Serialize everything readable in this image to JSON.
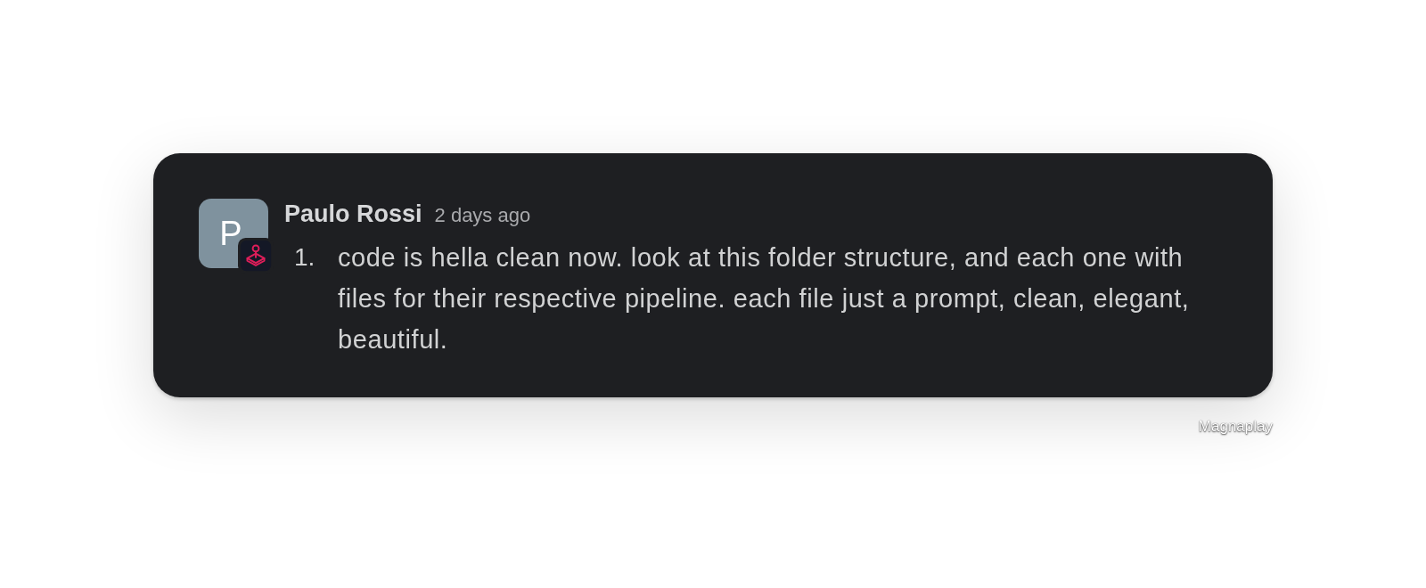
{
  "message": {
    "avatar_initial": "P",
    "author": "Paulo Rossi",
    "timestamp": "2 days ago",
    "list": [
      {
        "marker": "1.",
        "text": "code is hella clean now. look at this folder structure, and each one with files for their respective pipeline. each file just a prompt, clean, elegant, beautiful."
      }
    ]
  },
  "footer": {
    "label": "Magnaplay"
  }
}
